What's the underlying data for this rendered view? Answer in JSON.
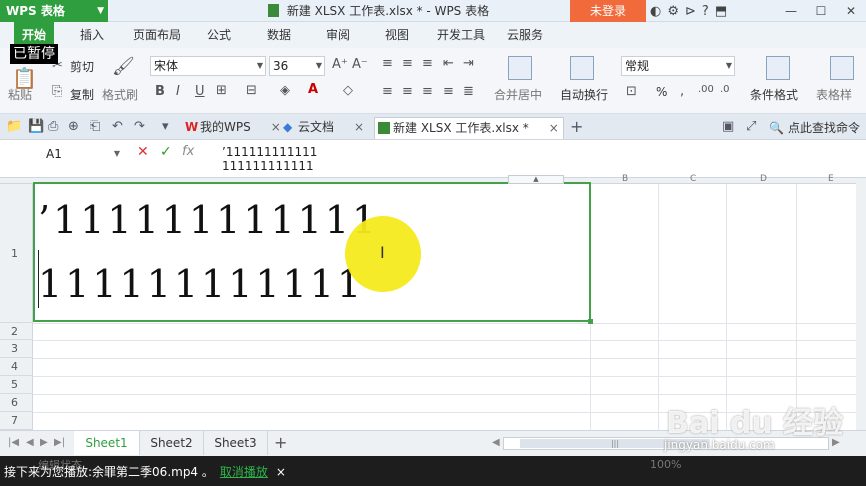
{
  "titlebar": {
    "app": "WPS 表格",
    "title": "新建 XLSX 工作表.xlsx * - WPS 表格",
    "login": "未登录"
  },
  "tabs": [
    "开始",
    "插入",
    "页面布局",
    "公式",
    "数据",
    "审阅",
    "视图",
    "开发工具",
    "云服务"
  ],
  "paused": "已暂停",
  "ribbon": {
    "paste": "粘贴",
    "cut": "剪切",
    "copy": "复制",
    "format_painter": "格式刷",
    "font": "宋体",
    "size": "36",
    "merge": "合并居中",
    "wrap": "自动换行",
    "number_format": "常规",
    "percent": "%",
    "cond_format": "条件格式",
    "table_style": "表格样"
  },
  "doctabs": {
    "mywps": "我的WPS",
    "cloud": "云文档",
    "current": "新建 XLSX 工作表.xlsx *",
    "search": "点此查找命令"
  },
  "formula": {
    "cell_ref": "A1",
    "line1": "’111111111111",
    "line2": "111111111111"
  },
  "grid": {
    "rows": [
      "1",
      "2",
      "3",
      "4",
      "5",
      "6",
      "7"
    ],
    "columns": [
      "B",
      "C",
      "D",
      "E"
    ],
    "cell_line1": "’111111111111",
    "cell_line2": "111111111111"
  },
  "sheets": [
    "Sheet1",
    "Sheet2",
    "Sheet3"
  ],
  "notice": {
    "text": "接下来为您播放:余罪第二季06.mp4 。",
    "cancel": "取消播放",
    "close": "×"
  },
  "status_ghost": "编辑状态",
  "zoom_ghost": "100%",
  "watermark": {
    "logo": "Bai du 经验",
    "url": "jingyan.baidu.com"
  }
}
